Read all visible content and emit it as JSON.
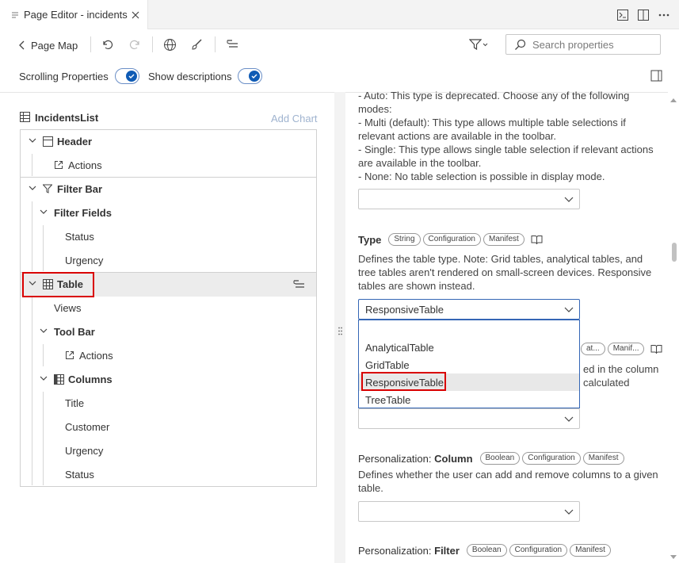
{
  "tab": {
    "title": "Page Editor - incidents"
  },
  "toolbar": {
    "back_label": "Page Map",
    "search_placeholder": "Search properties"
  },
  "settings": {
    "scrolling_label": "Scrolling Properties",
    "show_desc_label": "Show descriptions",
    "scrolling_on": true,
    "show_desc_on": true
  },
  "tree": {
    "title": "IncidentsList",
    "add_chart": "Add Chart",
    "header": "Header",
    "header_actions": "Actions",
    "filter_bar": "Filter Bar",
    "filter_fields": "Filter Fields",
    "ff_status": "Status",
    "ff_urgency": "Urgency",
    "table": "Table",
    "views": "Views",
    "tool_bar": "Tool Bar",
    "tb_actions": "Actions",
    "columns": "Columns",
    "col_title": "Title",
    "col_customer": "Customer",
    "col_urgency": "Urgency",
    "col_status": "Status"
  },
  "props": {
    "selection_desc": [
      "- Auto: This type is deprecated. Choose any of the following",
      "modes:",
      "- Multi (default): This type allows multiple table selections if",
      "relevant actions are available in the toolbar.",
      "- Single: This type allows single table selection if relevant actions",
      "are available in the toolbar.",
      "- None: No table selection is possible in display mode."
    ],
    "type_title": "Type",
    "type_chips": [
      "String",
      "Configuration",
      "Manifest"
    ],
    "type_desc": [
      "Defines the table type. Note: Grid tables, analytical tables, and",
      "tree tables aren't rendered on small-screen devices. Responsive",
      "tables are shown instead."
    ],
    "type_value": "ResponsiveTable",
    "hidden_chips": [
      "at...",
      "Manif..."
    ],
    "hidden_desc": [
      "ed in the column",
      "calculated"
    ],
    "type_options": [
      "AnalyticalTable",
      "GridTable",
      "ResponsiveTable",
      "TreeTable"
    ],
    "pers_column_prefix": "Personalization: ",
    "pers_column_title": "Column",
    "pers_column_chips": [
      "Boolean",
      "Configuration",
      "Manifest"
    ],
    "pers_column_desc": [
      "Defines whether the user can add and remove columns to a given",
      "table."
    ],
    "pers_filter_prefix": "Personalization: ",
    "pers_filter_title": "Filter",
    "pers_filter_chips": [
      "Boolean",
      "Configuration",
      "Manifest"
    ]
  }
}
